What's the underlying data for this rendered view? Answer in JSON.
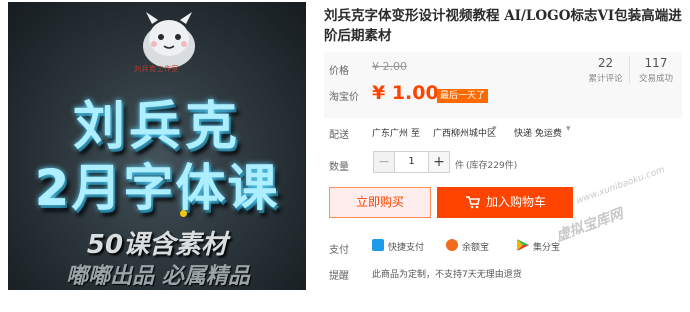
{
  "product_image": {
    "brand_text": "刘兵克工作室",
    "line1": "刘兵克",
    "line2": "2月字体课",
    "line3": "50课含素材",
    "line4": "嘟嘟出品 必属精品"
  },
  "product": {
    "title": "刘兵克字体变形设计视频教程 AI/LOGO标志VI包装高端进阶后期素材"
  },
  "price_panel": {
    "price_label": "价格",
    "original_price": "¥ 2.00",
    "promo_label": "淘宝价",
    "promo_price": "¥ 1.00",
    "promo_badge": "最后一天了",
    "reviews_count": "22",
    "reviews_caption": "累计评论",
    "deals_count": "117",
    "deals_caption": "交易成功"
  },
  "shipping": {
    "label": "配送",
    "from": "广东广州 至",
    "to": "广西柳州城中区",
    "method": "快递 免运费"
  },
  "quantity": {
    "label": "数量",
    "minus": "−",
    "value": "1",
    "plus": "+",
    "unit": "件",
    "stock": "(库存229件)"
  },
  "actions": {
    "buy_now": "立即购买",
    "add_to_cart": "加入购物车"
  },
  "payment": {
    "label": "支付",
    "quick": "快捷支付",
    "yuebao": "余额宝",
    "installment": "集分宝"
  },
  "notice": {
    "label": "提醒",
    "text": "此商品为定制，不支持7天无理由退货"
  },
  "watermark": {
    "url": "www.xunibaoku.com",
    "name": "虚拟宝库网"
  },
  "colors": {
    "accent": "#ff4400",
    "badge": "#ff6a00",
    "buy_now_bg": "#ffeded",
    "price_panel_bg": "#f8f8f8",
    "image_text": "#aeefff"
  }
}
